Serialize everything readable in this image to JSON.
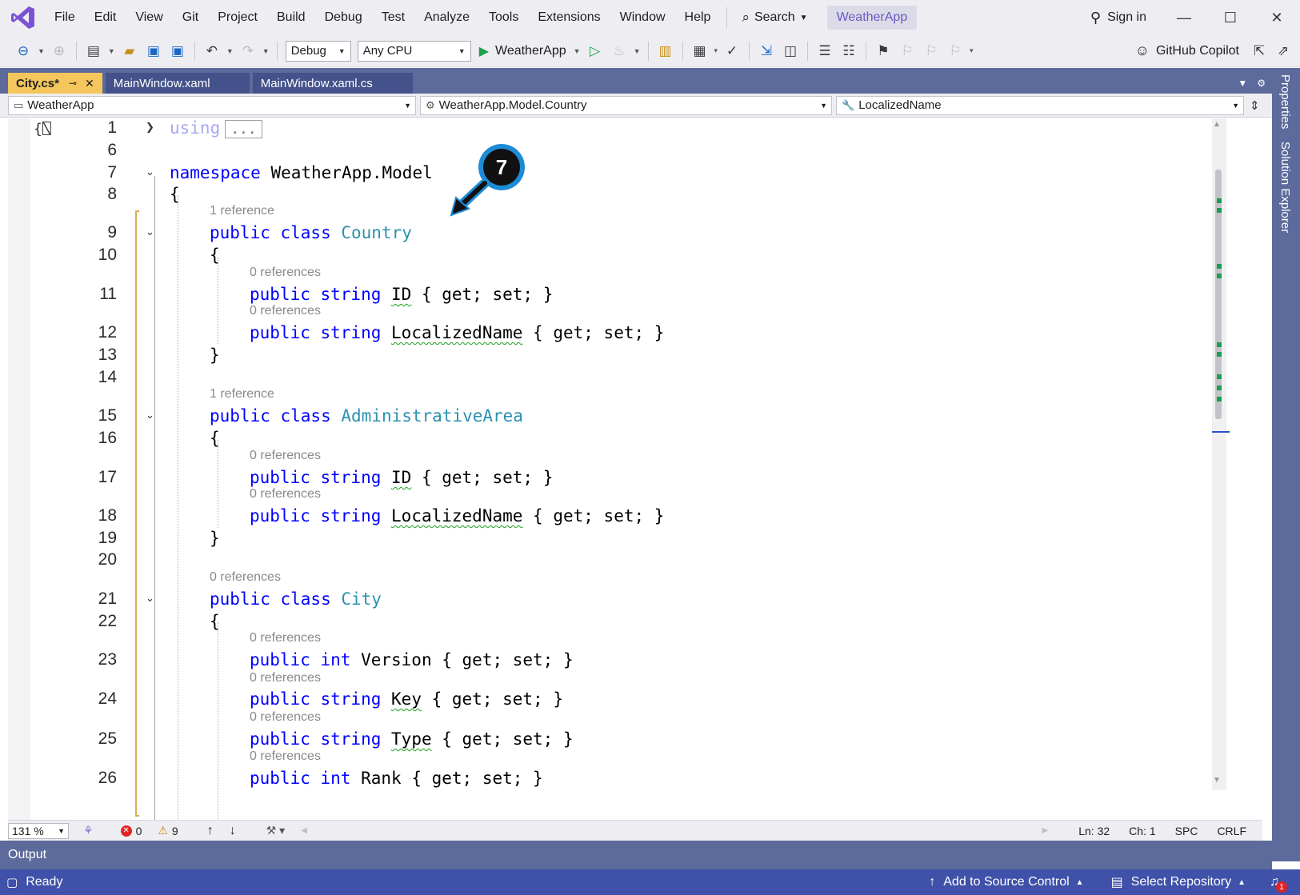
{
  "menu": {
    "items": [
      "File",
      "Edit",
      "View",
      "Git",
      "Project",
      "Build",
      "Debug",
      "Test",
      "Analyze",
      "Tools",
      "Extensions",
      "Window",
      "Help"
    ],
    "search_label": "Search",
    "solution_name": "WeatherApp",
    "sign_in": "Sign in"
  },
  "toolbar": {
    "configuration": "Debug",
    "platform": "Any CPU",
    "run_target": "WeatherApp",
    "copilot": "GitHub Copilot"
  },
  "tabs": [
    {
      "label": "City.cs*",
      "active": true
    },
    {
      "label": "MainWindow.xaml",
      "active": false
    },
    {
      "label": "MainWindow.xaml.cs",
      "active": false
    }
  ],
  "navbar": {
    "project": "WeatherApp",
    "type": "WeatherApp.Model.Country",
    "member": "LocalizedName"
  },
  "side_panel": {
    "properties": "Properties",
    "solution_explorer": "Solution Explorer"
  },
  "editor": {
    "lines": [
      {
        "num": "1",
        "code": "using",
        "collapsed": "..."
      },
      {
        "num": "6"
      },
      {
        "num": "7",
        "kw": "namespace",
        "rest": " WeatherApp.Model"
      },
      {
        "num": "8",
        "code": "{"
      },
      {
        "lens": "1 reference"
      },
      {
        "num": "9",
        "kw": "public class",
        "type": "Country"
      },
      {
        "num": "10",
        "code": "{"
      },
      {
        "lens": "0 references"
      },
      {
        "num": "11",
        "kw": "public string",
        "name": "ID",
        "acc": " { get; set; }"
      },
      {
        "lens": "0 references"
      },
      {
        "num": "12",
        "kw": "public string",
        "name": "LocalizedName",
        "acc": " { get; set; }"
      },
      {
        "num": "13",
        "code": "}"
      },
      {
        "num": "14"
      },
      {
        "lens": "1 reference"
      },
      {
        "num": "15",
        "kw": "public class",
        "type": "AdministrativeArea"
      },
      {
        "num": "16",
        "code": "{"
      },
      {
        "lens": "0 references"
      },
      {
        "num": "17",
        "kw": "public string",
        "name": "ID",
        "acc": " { get; set; }"
      },
      {
        "lens": "0 references"
      },
      {
        "num": "18",
        "kw": "public string",
        "name": "LocalizedName",
        "acc": " { get; set; }"
      },
      {
        "num": "19",
        "code": "}"
      },
      {
        "num": "20"
      },
      {
        "lens": "0 references"
      },
      {
        "num": "21",
        "kw": "public class",
        "type": "City"
      },
      {
        "num": "22",
        "code": "{"
      },
      {
        "lens": "0 references"
      },
      {
        "num": "23",
        "kw": "public int",
        "name": "Version",
        "acc": " { get; set; }"
      },
      {
        "lens": "0 references"
      },
      {
        "num": "24",
        "kw": "public string",
        "name": "Key",
        "acc": " { get; set; }"
      },
      {
        "lens": "0 references"
      },
      {
        "num": "25",
        "kw": "public string",
        "name": "Type",
        "acc": " { get; set; }"
      },
      {
        "lens": "0 references"
      },
      {
        "num": "26",
        "kw": "public int",
        "name": "Rank",
        "acc": " { get; set; }"
      }
    ]
  },
  "callout": {
    "number": "7"
  },
  "editor_status": {
    "zoom": "131 %",
    "errors": "0",
    "warnings": "9",
    "line": "Ln: 32",
    "column": "Ch: 1",
    "whitespace": "SPC",
    "line_endings": "CRLF"
  },
  "output": {
    "title": "Output"
  },
  "statusbar": {
    "state": "Ready",
    "add_source_control": "Add to Source Control",
    "select_repository": "Select Repository",
    "notifications": "1"
  },
  "colors": {
    "keyword": "#0000ff",
    "type": "#2b91af",
    "active_tab": "#f4c65c",
    "chrome": "#5c6b9b",
    "statusbar": "#3f51a8"
  }
}
